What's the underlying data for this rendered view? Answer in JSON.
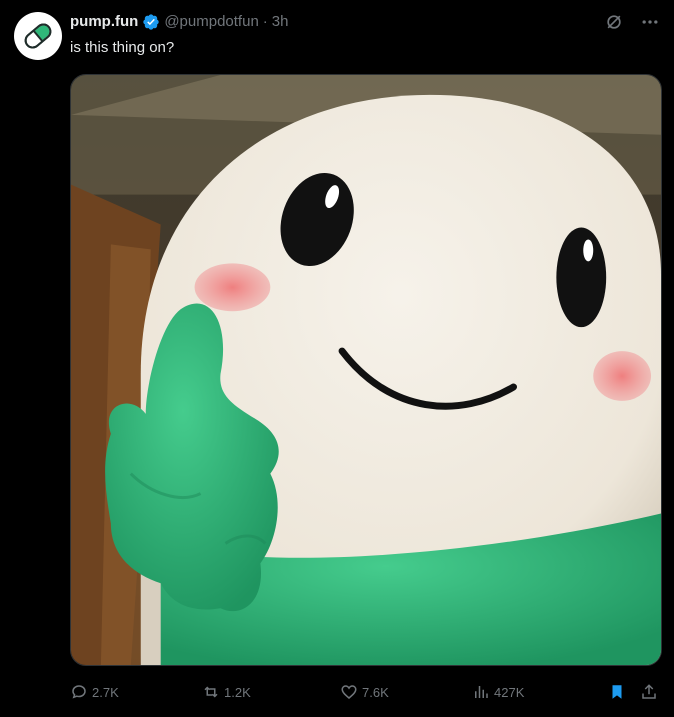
{
  "author": {
    "name": "pump.fun",
    "handle": "@pumpdotfun",
    "dot": "·",
    "time": "3h",
    "avatar_icon": "pill-icon",
    "verified_icon": "verified-badge-icon"
  },
  "post": {
    "text": "is this thing on?",
    "media_description": "pill-mascot-plush-pointing"
  },
  "top_actions": {
    "grok_icon": "grok-icon",
    "more_icon": "more-icon"
  },
  "engagement": {
    "replies": "2.7K",
    "reposts": "1.2K",
    "likes": "7.6K",
    "views": "427K"
  },
  "colors": {
    "background": "#000000",
    "text": "#e7e9ea",
    "muted": "#71767b",
    "verified": "#1d9bf0",
    "bookmark_active": "#1d9bf0",
    "mascot_green": "#2fb779",
    "mascot_body": "#f3eee6",
    "cheek": "#ef8f8f"
  }
}
